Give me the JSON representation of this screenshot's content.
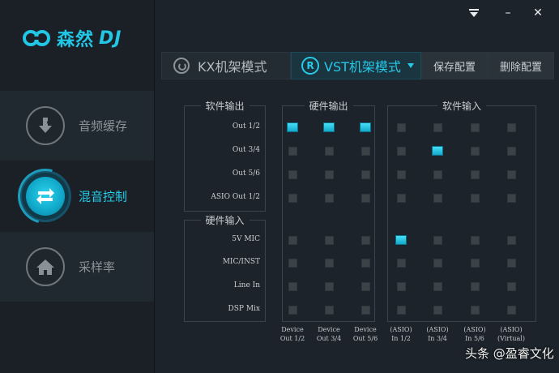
{
  "app": {
    "brand": "森然",
    "brand_suffix": "DJ"
  },
  "sidebar": {
    "items": [
      {
        "label": "音频缓存",
        "icon": "music-download-icon"
      },
      {
        "label": "混音控制",
        "icon": "swap-arrows-icon",
        "active": true
      },
      {
        "label": "采样率",
        "icon": "home-icon"
      }
    ]
  },
  "titlebar": {
    "menu_icon": "dropdown-menu-icon",
    "minimize": "–",
    "close": "✕"
  },
  "tabs": {
    "kx": "KX机架模式",
    "vst_badge": "R",
    "vst": "VST机架模式",
    "save": "保存配置",
    "delete": "删除配置"
  },
  "matrix": {
    "groups": {
      "soft_out": "软件输出",
      "hw_in": "硬件输入",
      "hw_out": "硬件输出",
      "soft_in": "软件输入"
    },
    "rows": [
      "Out 1/2",
      "Out 3/4",
      "Out 5/6",
      "ASIO Out 1/2",
      "5V MIC",
      "MIC/INST",
      "Line In",
      "DSP Mix"
    ],
    "columns": [
      [
        "Device",
        "Out 1/2"
      ],
      [
        "Device",
        "Out 3/4"
      ],
      [
        "Device",
        "Out 5/6"
      ],
      [
        "(ASIO)",
        "In 1/2"
      ],
      [
        "(ASIO)",
        "In 3/4"
      ],
      [
        "(ASIO)",
        "In 5/6"
      ],
      [
        "(ASIO)",
        "(Virtual)"
      ]
    ],
    "active_cells": [
      [
        0,
        0
      ],
      [
        0,
        1
      ],
      [
        0,
        2
      ],
      [
        1,
        4
      ],
      [
        4,
        3
      ]
    ]
  },
  "watermark": "头条 @盈睿文化",
  "colors": {
    "accent": "#22c7e6",
    "background": "#1c232a",
    "sidebar": "#1a2026"
  }
}
